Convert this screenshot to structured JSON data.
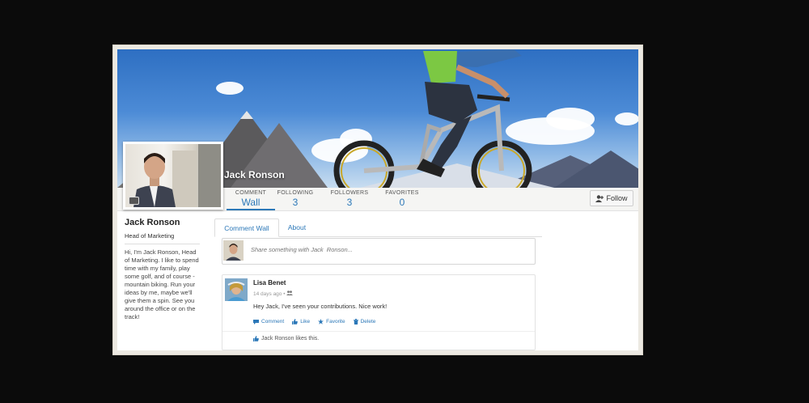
{
  "profile": {
    "name": "Jack Ronson",
    "title": "Head of Marketing",
    "bio": "Hi, I'm Jack Ronson, Head of Marketing. I like to spend time with my family, play some golf, and of course - mountain biking. Run your ideas by me, maybe we'll give them a spin. See you around the office or on the track!"
  },
  "stats": [
    {
      "label": "COMMENT",
      "value": "Wall"
    },
    {
      "label": "FOLLOWING",
      "value": "3"
    },
    {
      "label": "FOLLOWERS",
      "value": "3"
    },
    {
      "label": "FAVORITES",
      "value": "0"
    }
  ],
  "follow_label": "Follow",
  "tabs": [
    "Comment Wall",
    "About"
  ],
  "share_placeholder": "Share something with Jack  Ronson...",
  "post": {
    "author": "Lisa Benet",
    "meta": "14 days ago •",
    "text": "Hey Jack, I've seen your contributions. Nice work!",
    "actions": [
      "Comment",
      "Like",
      "Favorite",
      "Delete"
    ],
    "likes": "Jack Ronson likes this."
  },
  "colors": {
    "accent": "#2c78b8",
    "background": "#0b0b0b"
  },
  "icons": [
    "camera-icon",
    "follow-user-icon",
    "comment-icon",
    "like-icon",
    "star-icon",
    "delete-icon",
    "group-icon"
  ]
}
